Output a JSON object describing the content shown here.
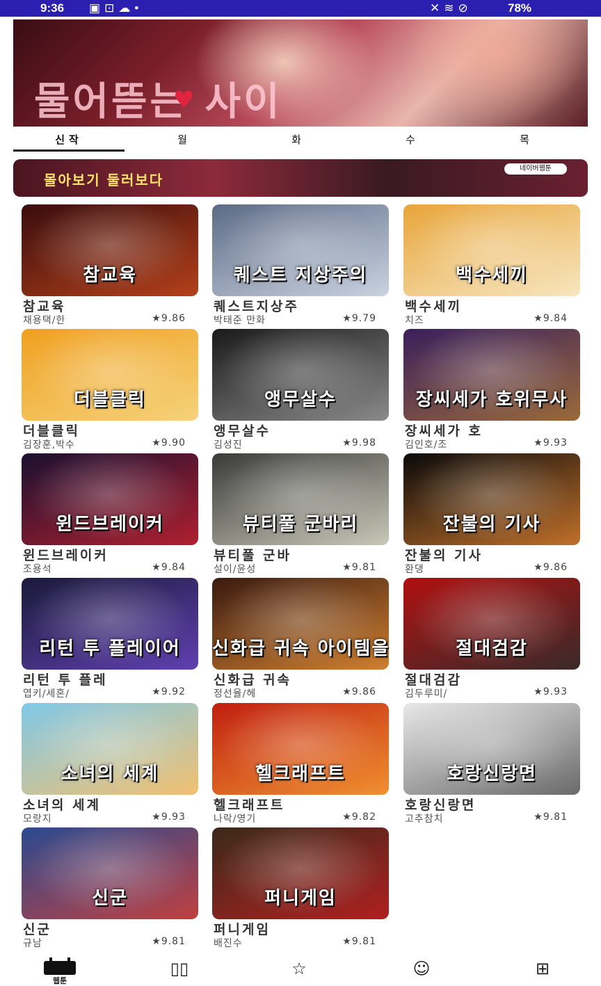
{
  "status_bar": {
    "time": "9:36",
    "left_icons": [
      "photo-icon",
      "screen-icon",
      "cloud-icon",
      "dot-icon"
    ],
    "right_icons": [
      "mute-icon",
      "wifi-icon",
      "dnd-icon"
    ],
    "battery": "78%"
  },
  "hero": {
    "title": "물어뜯는 사이"
  },
  "tabs": [
    {
      "label": "신작",
      "active": true
    },
    {
      "label": "월",
      "active": false
    },
    {
      "label": "화",
      "active": false
    },
    {
      "label": "수",
      "active": false
    },
    {
      "label": "목",
      "active": false
    }
  ],
  "ad": {
    "text": "몰아보기 둘러보다",
    "badge": "네이버웹툰"
  },
  "comics": [
    {
      "title": "참교육",
      "cover_text": "참교육",
      "author": "채용택/한",
      "rating": "★9.86",
      "bg": [
        "#3a0d0d",
        "#b3401a"
      ]
    },
    {
      "title": "퀘스트지상주",
      "cover_text": "퀘스트 지상주의",
      "author": "박태준 만화",
      "rating": "★9.79",
      "bg": [
        "#5c6b85",
        "#c9d2e0"
      ]
    },
    {
      "title": "백수세끼",
      "cover_text": "백수세끼",
      "author": "치즈",
      "rating": "★9.84",
      "bg": [
        "#e8a53a",
        "#f7e6c0"
      ]
    },
    {
      "title": "더블클릭",
      "cover_text": "더블클릭",
      "author": "김장훈,박수",
      "rating": "★9.90",
      "bg": [
        "#f0a020",
        "#f5d27a"
      ]
    },
    {
      "title": "앵무살수",
      "cover_text": "앵무살수",
      "author": "김성진",
      "rating": "★9.98",
      "bg": [
        "#1a1a1a",
        "#8a8a8a"
      ]
    },
    {
      "title": "장씨세가 호",
      "cover_text": "장씨세가 호위무사",
      "author": "김인호/조",
      "rating": "★9.93",
      "bg": [
        "#3a1f5c",
        "#9a6a3a"
      ]
    },
    {
      "title": "윈드브레이커",
      "cover_text": "윈드브레이커",
      "author": "조용석",
      "rating": "★9.84",
      "bg": [
        "#1a1030",
        "#b02030"
      ]
    },
    {
      "title": "뷰티풀 군바",
      "cover_text": "뷰티풀 군바리",
      "author": "설이/윤성",
      "rating": "★9.81",
      "bg": [
        "#3a3a3a",
        "#c8c8b8"
      ]
    },
    {
      "title": "잔불의 기사",
      "cover_text": "잔불의 기사",
      "author": "환댕",
      "rating": "★9.86",
      "bg": [
        "#0a0a0a",
        "#c0702a"
      ]
    },
    {
      "title": "리턴 투 플레",
      "cover_text": "리턴 투 플레이어",
      "author": "엽키/세혼/",
      "rating": "★9.92",
      "bg": [
        "#1a1a3a",
        "#6040b0"
      ]
    },
    {
      "title": "신화급 귀속",
      "cover_text": "신화급 귀속 아이템을 손에 넣었다",
      "author": "정선율/헤",
      "rating": "★9.86",
      "bg": [
        "#3a1a10",
        "#d08030"
      ]
    },
    {
      "title": "절대검감",
      "cover_text": "절대검감",
      "author": "김두루미/",
      "rating": "★9.93",
      "bg": [
        "#b01010",
        "#3a2a2a"
      ]
    },
    {
      "title": "소녀의 세계",
      "cover_text": "소녀의 세계",
      "author": "모랑지",
      "rating": "★9.93",
      "bg": [
        "#7ec8e8",
        "#f2c070"
      ]
    },
    {
      "title": "헬크래프트",
      "cover_text": "헬크래프트",
      "author": "나락/영기",
      "rating": "★9.82",
      "bg": [
        "#c02010",
        "#f09030"
      ]
    },
    {
      "title": "호랑신랑면",
      "cover_text": "호랑신랑면",
      "author": "고추참치",
      "rating": "★9.81",
      "bg": [
        "#e8e8e8",
        "#6a6a6a"
      ]
    },
    {
      "title": "신군",
      "cover_text": "신군",
      "author": "규남",
      "rating": "★9.81",
      "bg": [
        "#2a4a90",
        "#c04040"
      ]
    },
    {
      "title": "퍼니게임",
      "cover_text": "퍼니게임",
      "author": "배진수",
      "rating": "★9.81",
      "bg": [
        "#3a2a1a",
        "#b02020"
      ]
    }
  ],
  "bottom_nav": [
    {
      "label": "웹툰",
      "icon": "calendar-icon"
    },
    {
      "label": "",
      "icon": "book-icon"
    },
    {
      "label": "",
      "icon": "star-icon"
    },
    {
      "label": "",
      "icon": "smiley-icon"
    },
    {
      "label": "",
      "icon": "grid-icon"
    }
  ]
}
